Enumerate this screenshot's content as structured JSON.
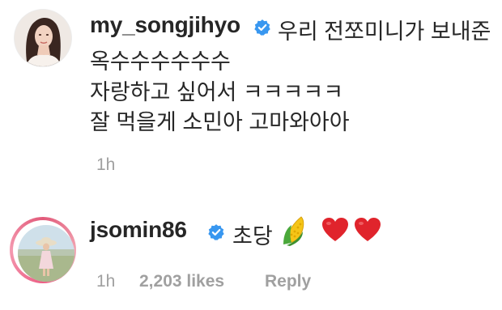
{
  "comment_1": {
    "username": "my_songjihyo",
    "verified": true,
    "lines": [
      "우리 전쪼미니가 보내준",
      "옥수수수수수수",
      "자랑하고 싶어서 ㅋㅋㅋㅋㅋ",
      "잘 먹을게 소민아 고마와아아"
    ],
    "time": "1h"
  },
  "comment_2": {
    "username": "jsomin86",
    "verified": true,
    "text": "초당",
    "emojis": [
      "corn-emoji",
      "heart-emoji",
      "heart-emoji"
    ],
    "time": "1h",
    "likes": "2,203 likes",
    "reply_label": "Reply"
  },
  "colors": {
    "text": "#262626",
    "meta": "#a0a0a0",
    "verified_blue": "#3897f0",
    "heart_red": "#e0242c",
    "story_ring": "#e25a7a"
  }
}
